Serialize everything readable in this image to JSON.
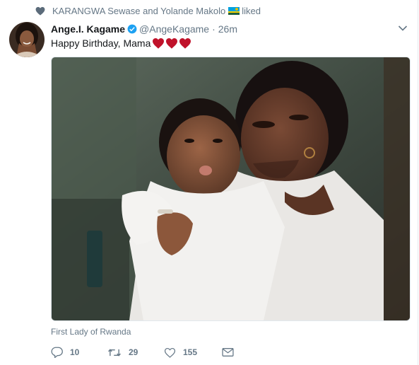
{
  "context": {
    "icon": "heart-icon",
    "text_before_flag": "KARANGWA Sewase and Yolande Makolo",
    "text_after_flag": "liked"
  },
  "tweet": {
    "display_name": "Ange.I. Kagame",
    "handle": "@AngeKagame",
    "separator": "·",
    "timestamp": "26m",
    "text": "Happy Birthday, Mama",
    "location": "First Lady of Rwanda"
  },
  "actions": {
    "reply_count": "10",
    "retweet_count": "29",
    "like_count": "155"
  },
  "colors": {
    "accent": "#1da1f2",
    "muted": "#657786",
    "heart_red": "#c0122a"
  }
}
